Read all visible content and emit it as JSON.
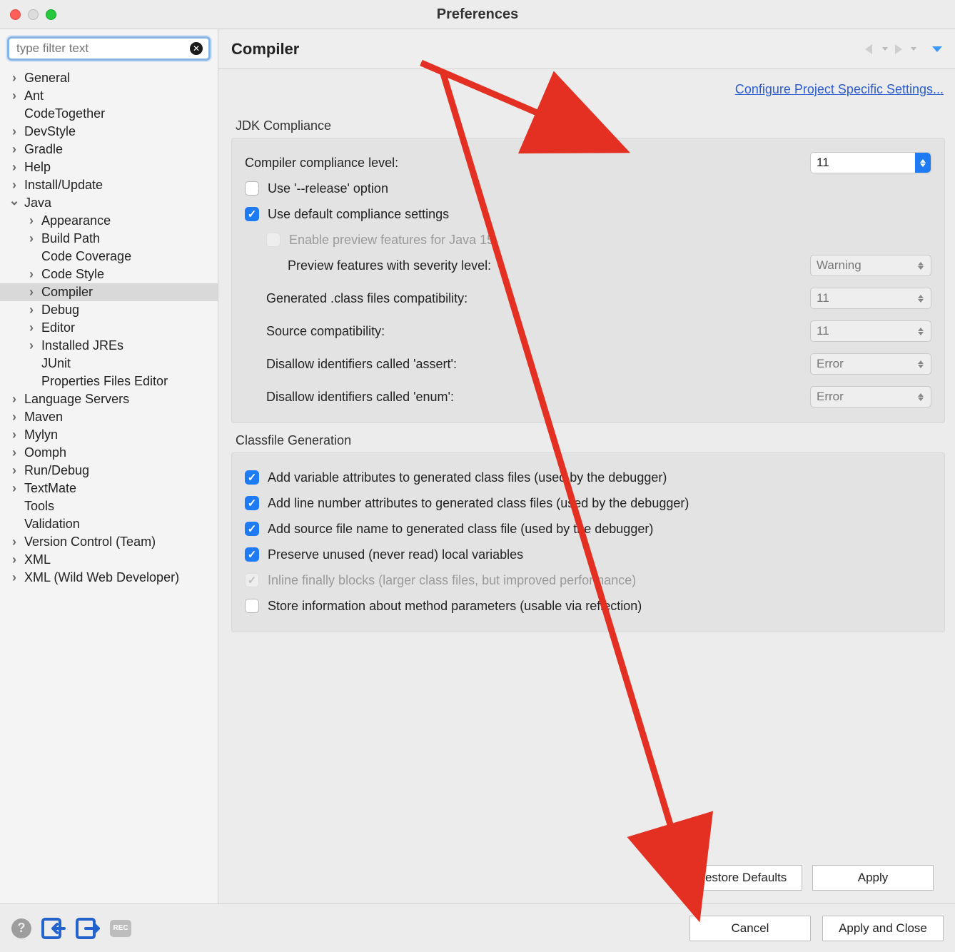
{
  "window": {
    "title": "Preferences"
  },
  "sidebar": {
    "filter_placeholder": "type filter text",
    "items": [
      {
        "label": "General",
        "expandable": true
      },
      {
        "label": "Ant",
        "expandable": true
      },
      {
        "label": "CodeTogether",
        "expandable": false
      },
      {
        "label": "DevStyle",
        "expandable": true
      },
      {
        "label": "Gradle",
        "expandable": true
      },
      {
        "label": "Help",
        "expandable": true
      },
      {
        "label": "Install/Update",
        "expandable": true
      },
      {
        "label": "Java",
        "expandable": true,
        "open": true
      },
      {
        "label": "Language Servers",
        "expandable": true
      },
      {
        "label": "Maven",
        "expandable": true
      },
      {
        "label": "Mylyn",
        "expandable": true
      },
      {
        "label": "Oomph",
        "expandable": true
      },
      {
        "label": "Run/Debug",
        "expandable": true
      },
      {
        "label": "TextMate",
        "expandable": true
      },
      {
        "label": "Tools",
        "expandable": false
      },
      {
        "label": "Validation",
        "expandable": false
      },
      {
        "label": "Version Control (Team)",
        "expandable": true
      },
      {
        "label": "XML",
        "expandable": true
      },
      {
        "label": "XML (Wild Web Developer)",
        "expandable": true
      }
    ],
    "java_children": [
      {
        "label": "Appearance",
        "expandable": true
      },
      {
        "label": "Build Path",
        "expandable": true
      },
      {
        "label": "Code Coverage",
        "expandable": false
      },
      {
        "label": "Code Style",
        "expandable": true
      },
      {
        "label": "Compiler",
        "expandable": true,
        "selected": true
      },
      {
        "label": "Debug",
        "expandable": true
      },
      {
        "label": "Editor",
        "expandable": true
      },
      {
        "label": "Installed JREs",
        "expandable": true
      },
      {
        "label": "JUnit",
        "expandable": false
      },
      {
        "label": "Properties Files Editor",
        "expandable": false
      }
    ]
  },
  "page": {
    "title": "Compiler",
    "link": "Configure Project Specific Settings...",
    "jdk": {
      "group_label": "JDK Compliance",
      "level_label": "Compiler compliance level:",
      "level_value": "11",
      "release_label": "Use '--release' option",
      "defaults_label": "Use default compliance settings",
      "preview_label": "Enable preview features for Java 15",
      "severity_label": "Preview features with severity level:",
      "severity_value": "Warning",
      "gen_class_label": "Generated .class files compatibility:",
      "gen_class_value": "11",
      "source_label": "Source compatibility:",
      "source_value": "11",
      "assert_label": "Disallow identifiers called 'assert':",
      "assert_value": "Error",
      "enum_label": "Disallow identifiers called 'enum':",
      "enum_value": "Error"
    },
    "classfile": {
      "group_label": "Classfile Generation",
      "var_attr": "Add variable attributes to generated class files (used by the debugger)",
      "line_attr": "Add line number attributes to generated class files (used by the debugger)",
      "source_attr": "Add source file name to generated class file (used by the debugger)",
      "preserve": "Preserve unused (never read) local variables",
      "inline": "Inline finally blocks (larger class files, but improved performance)",
      "params": "Store information about method parameters (usable via reflection)"
    },
    "buttons": {
      "restore": "Restore Defaults",
      "apply": "Apply",
      "cancel": "Cancel",
      "apply_close": "Apply and Close"
    }
  }
}
